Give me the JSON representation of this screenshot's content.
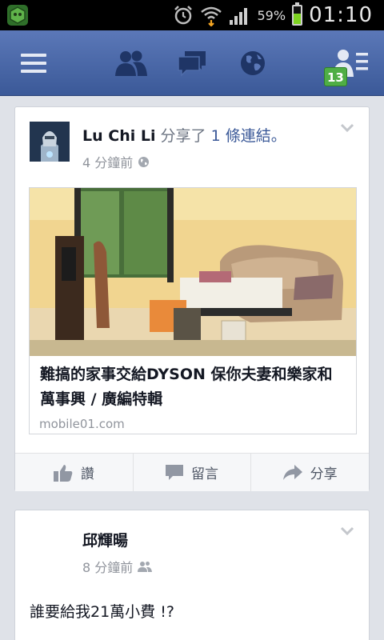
{
  "status_bar": {
    "battery_percent": "59%",
    "battery_level": 0.59,
    "time": "01:10",
    "icons": [
      "app-launcher-icon",
      "alarm-icon",
      "wifi-icon",
      "signal-icon",
      "battery-icon"
    ]
  },
  "navbar": {
    "icons": [
      "menu-icon",
      "friend-requests-icon",
      "messages-icon",
      "notifications-globe-icon",
      "friends-list-icon"
    ],
    "badge_count": "13",
    "accent_color": "#3b5998",
    "badge_color": "#4fae45"
  },
  "post1": {
    "author": "Lu Chi Li",
    "verb": "分享了",
    "object": "1 條連結。",
    "time": "4 分鐘前",
    "privacy_icon": "globe-icon",
    "link": {
      "title": "難搞的家事交給DYSON 保你夫妻和樂家和萬事興 / 廣編特輯",
      "domain": "mobile01.com"
    },
    "actions": {
      "like": "讚",
      "comment": "留言",
      "share": "分享"
    }
  },
  "post2": {
    "author": "邱輝暘",
    "time": "8 分鐘前",
    "privacy_icon": "friends-icon",
    "text": "誰要給我21萬小費 !?"
  }
}
